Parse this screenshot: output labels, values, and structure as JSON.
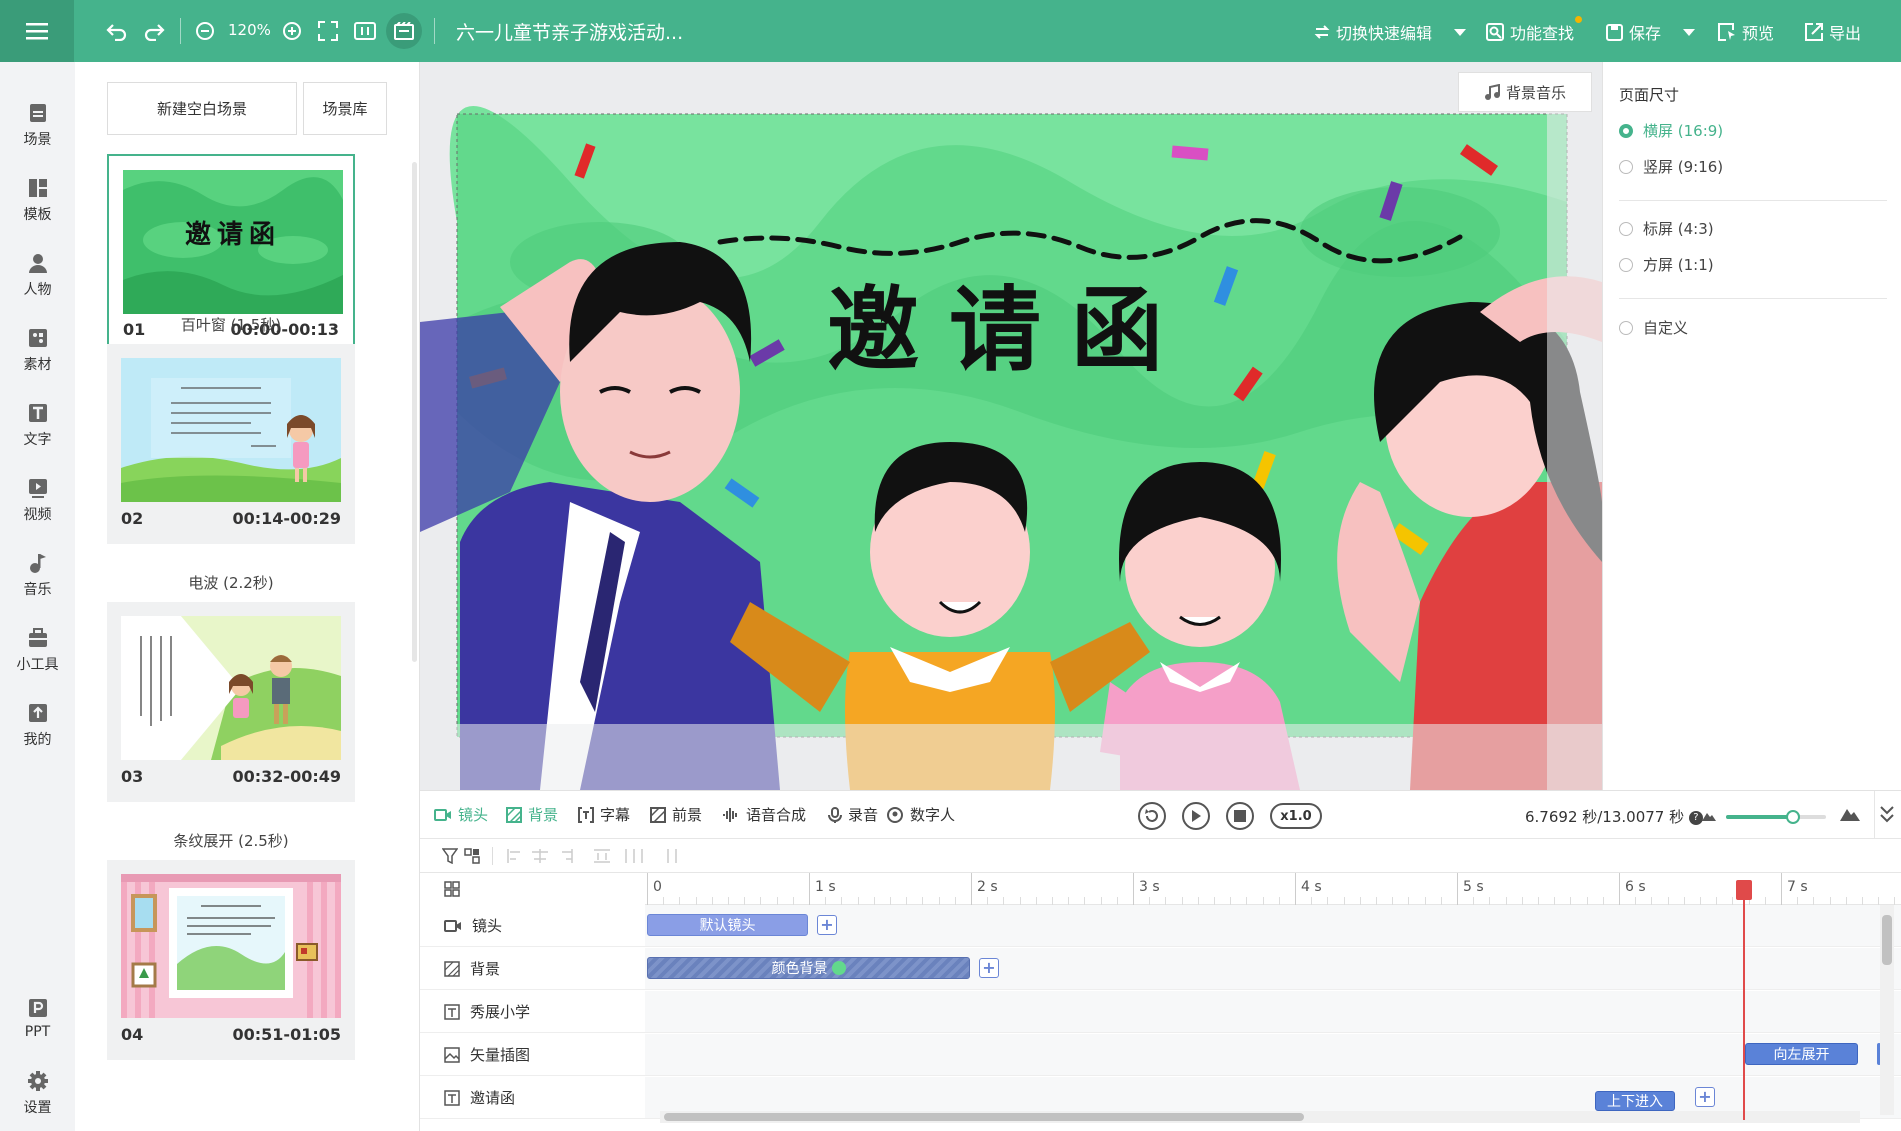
{
  "topbar": {
    "zoom": "120%",
    "doc_title": "六一儿童节亲子游戏活动...",
    "quick_edit": "切换快速编辑",
    "feature_search": "功能查找",
    "save": "保存",
    "preview": "预览",
    "export": "导出"
  },
  "nav": [
    {
      "label": "场景",
      "icon": "scene-icon"
    },
    {
      "label": "模板",
      "icon": "template-icon"
    },
    {
      "label": "人物",
      "icon": "person-icon"
    },
    {
      "label": "素材",
      "icon": "material-icon"
    },
    {
      "label": "文字",
      "icon": "text-icon"
    },
    {
      "label": "视频",
      "icon": "video-icon"
    },
    {
      "label": "音乐",
      "icon": "music-icon"
    },
    {
      "label": "小工具",
      "icon": "toolbox-icon"
    },
    {
      "label": "我的",
      "icon": "upload-icon"
    },
    {
      "label": "PPT",
      "icon": "ppt-icon"
    },
    {
      "label": "设置",
      "icon": "gear-icon"
    }
  ],
  "scenes_panel": {
    "new_blank": "新建空白场景",
    "library": "场景库",
    "scenes": [
      {
        "num": "01",
        "time": "00:00-00:13",
        "transition": "百叶窗 (1.5秒)",
        "thumb_title": "邀请函"
      },
      {
        "num": "02",
        "time": "00:14-00:29",
        "transition": "电波 (2.2秒)"
      },
      {
        "num": "03",
        "time": "00:32-00:49",
        "transition": "条纹展开 (2.5秒)"
      },
      {
        "num": "04",
        "time": "00:51-01:05"
      }
    ]
  },
  "canvas": {
    "bgm_button": "背景音乐",
    "title": "邀请函"
  },
  "page_size": {
    "heading": "页面尺寸",
    "options": [
      "横屏 (16:9)",
      "竖屏 (9:16)",
      "标屏 (4:3)",
      "方屏 (1:1)",
      "自定义"
    ],
    "selected": "横屏 (16:9)"
  },
  "timeline": {
    "tabs": [
      "镜头",
      "背景",
      "字幕",
      "前景",
      "语音合成",
      "录音",
      "数字人"
    ],
    "speed": "x1.0",
    "time": "6.7692 秒/13.0077 秒",
    "ruler_labels": [
      "0",
      "1 s",
      "2 s",
      "3 s",
      "4 s",
      "5 s",
      "6 s",
      "7 s"
    ],
    "tracks": [
      "镜头",
      "背景",
      "秀展小学",
      "矢量插图",
      "邀请函"
    ],
    "clips": {
      "camera": "默认镜头",
      "background": "颜色背景",
      "vector_anim": "向左展开",
      "invite_anim": "上下进入"
    },
    "playhead_seconds": 6.77,
    "total_seconds": 13.0077
  },
  "colors": {
    "accent": "#45b38c",
    "clip_blue": "#7b8fe0",
    "playhead": "#e04a4a"
  }
}
